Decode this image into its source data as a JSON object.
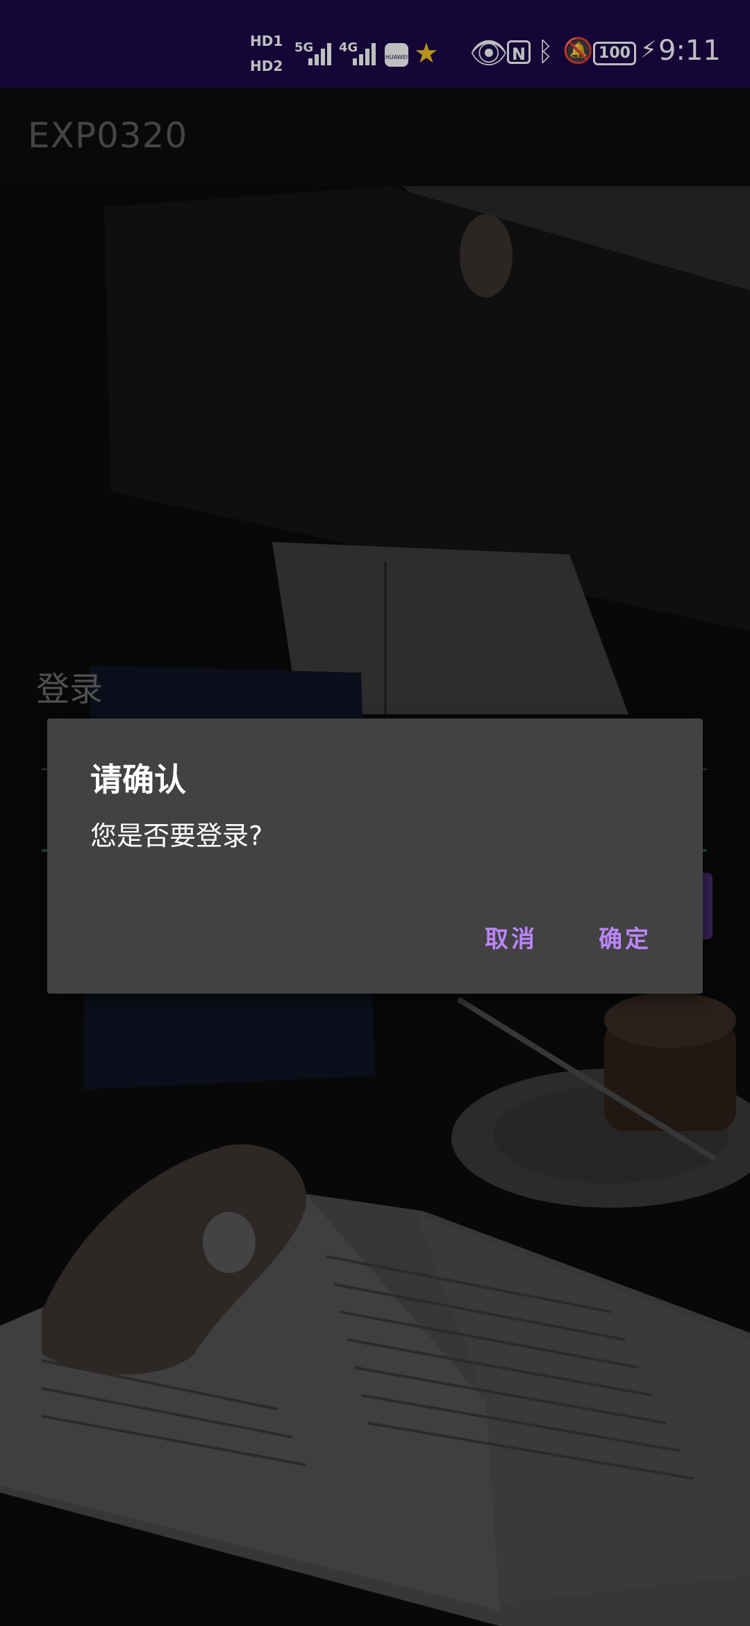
{
  "status_bar": {
    "hd1": "HD1",
    "hd2": "HD2",
    "net1": "5G",
    "net2": "4G",
    "battery": "100",
    "time": "9:11",
    "icons": [
      "hd-icon",
      "signal-5g-icon",
      "signal-4g-icon",
      "huawei-appgallery-icon",
      "star-icon",
      "eye-icon",
      "nfc-icon",
      "bluetooth-icon",
      "mute-bell-icon",
      "battery-icon",
      "charging-icon"
    ]
  },
  "app_bar": {
    "title": "EXP0320"
  },
  "login": {
    "label": "登录"
  },
  "dialog": {
    "title": "请确认",
    "message": "您是否要登录?",
    "cancel_label": "取消",
    "confirm_label": "确定"
  },
  "colors": {
    "status_bar_bg": "#1a0a4a",
    "dialog_bg": "#424242",
    "accent": "#bb86fc"
  }
}
